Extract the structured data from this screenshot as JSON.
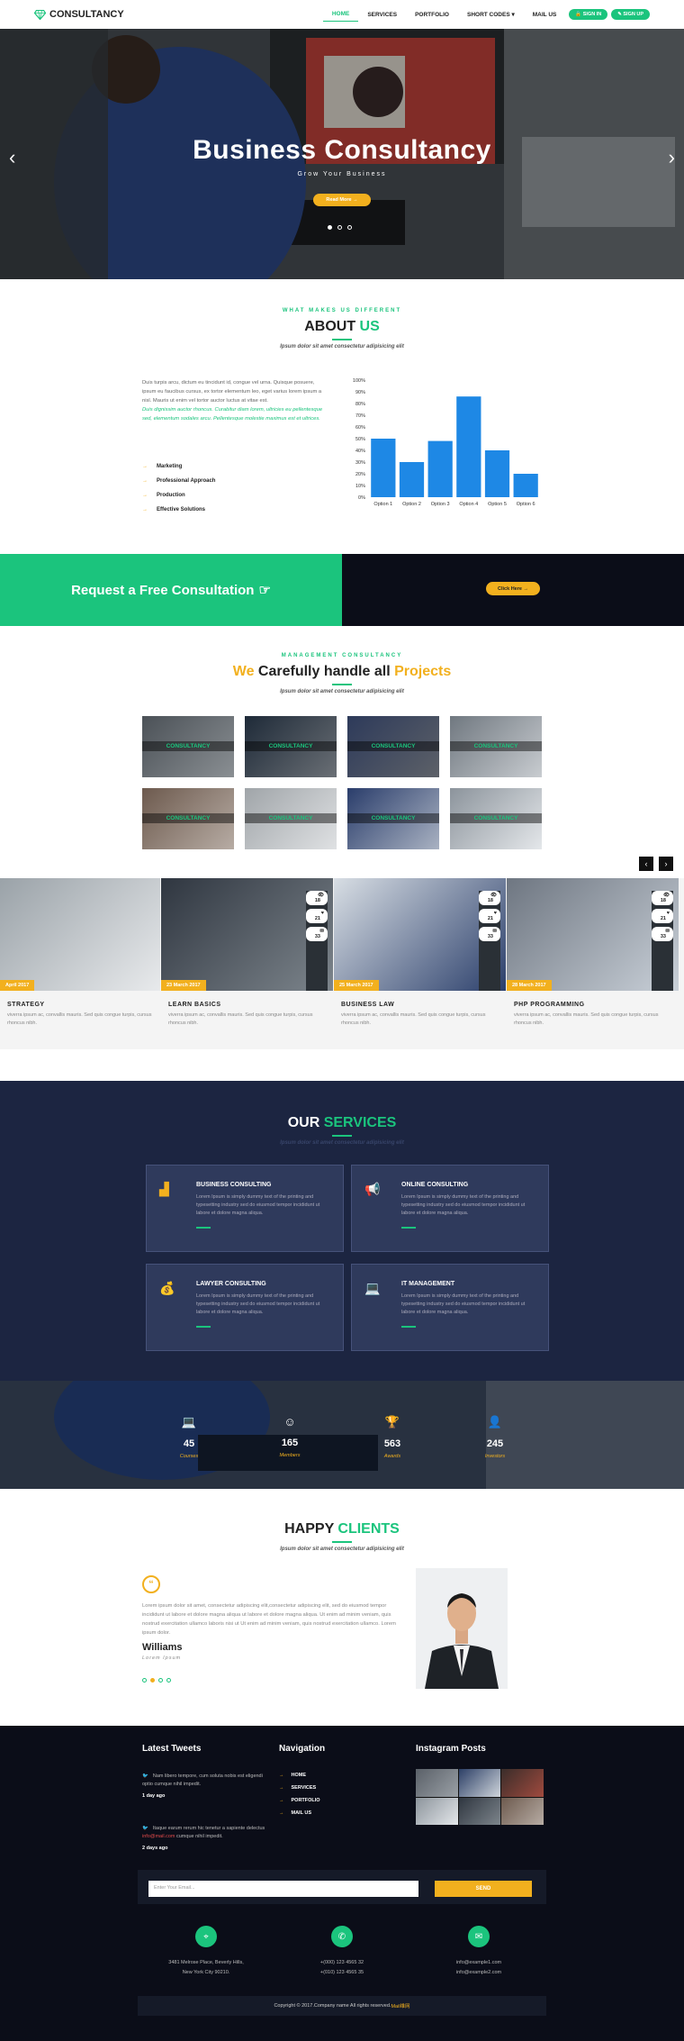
{
  "header": {
    "logo": "CONSULTANCY",
    "nav": [
      "HOME",
      "SERVICES",
      "PORTFOLIO",
      "SHORT CODES ▾",
      "MAIL US"
    ],
    "sign_in": "SIGN IN",
    "sign_up": "SIGN UP"
  },
  "hero": {
    "title": "Business Consultancy",
    "subtitle": "Grow Your Business",
    "button": "Read More →"
  },
  "about": {
    "kicker": "WHAT MAKES US DIFFERENT",
    "title_a": "ABOUT ",
    "title_b": "US",
    "subtitle": "Ipsum dolor sit amet consectetur adipisicing elit",
    "para": "Duis turpis arcu, dictum eu tincidunt id, congue vel urna. Quisque posuere, ipsum eu faucibus cursus, ex tortor elementum leo, eget varius lorem ipsum a nisl. Mauris ut enim vel tortor auctor luctus at vitae est.",
    "para_green": "Duis dignissim auctor rhoncus. Curabitur diam lorem, ultricies eu pellentesque sed, elementum sodales arcu. Pellentesque molestie maximus est et ultrices.",
    "list": [
      "Marketing",
      "Professional Approach",
      "Production",
      "Effective Solutions"
    ]
  },
  "chart_data": {
    "type": "bar",
    "categories": [
      "Option 1",
      "Option 2",
      "Option 3",
      "Option 4",
      "Option 5",
      "Option 6"
    ],
    "values": [
      50,
      30,
      48,
      86,
      40,
      20
    ],
    "ylim": [
      0,
      100
    ],
    "yticks": [
      "0%",
      "10%",
      "20%",
      "30%",
      "40%",
      "50%",
      "60%",
      "70%",
      "80%",
      "90%",
      "100%"
    ],
    "color": "#1e88e5",
    "grid": false
  },
  "cta": {
    "text": "Request a Free Consultation",
    "button": "Click Here →"
  },
  "projects": {
    "kicker": "MANAGEMENT CONSULTANCY",
    "title_a": "We ",
    "title_b": "Carefully handle all ",
    "title_c": "Projects",
    "subtitle": "Ipsum dolor sit amet consectetur adipisicing elit",
    "tile_label": "CONSULTANCY"
  },
  "blog": [
    {
      "date": "April 2017",
      "title": "STRATEGY",
      "text": "viverra ipsum ac, convallis mauris. Sed quis congue turpis, cursus rhoncus nibh.",
      "stats": []
    },
    {
      "date": "23 March 2017",
      "title": "LEARN BASICS",
      "text": "viverra ipsum ac, convallis mauris. Sed quis congue turpis, cursus rhoncus nibh.",
      "stats": [
        "18",
        "21",
        "33"
      ]
    },
    {
      "date": "25 March 2017",
      "title": "BUSINESS LAW",
      "text": "viverra ipsum ac, convallis mauris. Sed quis congue turpis, cursus rhoncus nibh.",
      "stats": [
        "18",
        "21",
        "33"
      ]
    },
    {
      "date": "28 March 2017",
      "title": "PHP PROGRAMMING",
      "text": "viverra ipsum ac, convallis mauris. Sed quis congue turpis, cursus rhoncus nibh.",
      "stats": [
        "18",
        "21",
        "33"
      ]
    }
  ],
  "services": {
    "title_a": "OUR ",
    "title_b": "SERVICES",
    "subtitle": "Ipsum dolor sit amet consectetur adipisicing elit",
    "items": [
      {
        "title": "BUSINESS CONSULTING",
        "text": "Lorem Ipsum is simply dummy text of the printing and typesetting industry sed do eiusmod tempor incididunt ut labore et dolore magna aliqua.",
        "icon": "bar-chart-icon"
      },
      {
        "title": "ONLINE CONSULTING",
        "text": "Lorem Ipsum is simply dummy text of the printing and typesetting industry sed do eiusmod tempor incididunt ut labore et dolore magna aliqua.",
        "icon": "megaphone-icon"
      },
      {
        "title": "LAWYER CONSULTING",
        "text": "Lorem Ipsum is simply dummy text of the printing and typesetting industry sed do eiusmod tempor incididunt ut labore et dolore magna aliqua.",
        "icon": "money-bag-icon"
      },
      {
        "title": "IT MANAGEMENT",
        "text": "Lorem Ipsum is simply dummy text of the printing and typesetting industry sed do eiusmod tempor incididunt ut labore et dolore magna aliqua.",
        "icon": "laptop-icon"
      }
    ]
  },
  "stats": [
    {
      "num": "45",
      "label": "Courses",
      "icon": "laptop-icon"
    },
    {
      "num": "165",
      "label": "Members",
      "icon": "smile-icon"
    },
    {
      "num": "563",
      "label": "Awards",
      "icon": "trophy-icon"
    },
    {
      "num": "245",
      "label": "Investors",
      "icon": "user-icon"
    }
  ],
  "clients": {
    "title_a": "HAPPY ",
    "title_b": "CLIENTS",
    "subtitle": "Ipsum dolor sit amet consectetur adipisicing elit",
    "quote": "Lorem ipsum dolor sit amet, consectetur adipiscing elit,consectetur adipiscing elit, sed do eiusmod tempor incididunt ut labore et dolore magna aliqua ut labore et dolore magna aliqua. Ut enim ad minim veniam, quis nostrud exercitation ullamco laboris nisi ut Ut enim ad minim veniam, quis nostrud exercitation ullamco. Lorem ipsum dolor.",
    "name": "Williams",
    "role": "Lorem Ipsum"
  },
  "footer": {
    "tweets_title": "Latest Tweets",
    "tweets": [
      {
        "text": "Nam libero tempore, cum soluta nobis est eligendi optio cumque nihil impedit.",
        "time": "1 day ago"
      },
      {
        "text_a": "Itaque earum rerum hic tenetur a sapiente delectus ",
        "link": "info@mail.com",
        "text_b": " cumque nihil impedit.",
        "time": "2 days ago"
      }
    ],
    "nav_title": "Navigation",
    "nav": [
      "HOME",
      "SERVICES",
      "PORTFOLIO",
      "MAIL US"
    ],
    "insta_title": "Instagram Posts",
    "newsletter_placeholder": "Enter Your Email...",
    "newsletter_button": "SEND",
    "address": [
      "3481 Melrose Place, Beverly Hills,",
      "New York City 90210."
    ],
    "phones": [
      "+(000) 123 4565 32",
      "+(010) 123 4565 35"
    ],
    "emails": [
      "info@example1.com",
      "info@example2.com"
    ],
    "copyright": "Copyright © 2017.Company name All rights reserved.",
    "copyright_link": "Mail维网"
  }
}
